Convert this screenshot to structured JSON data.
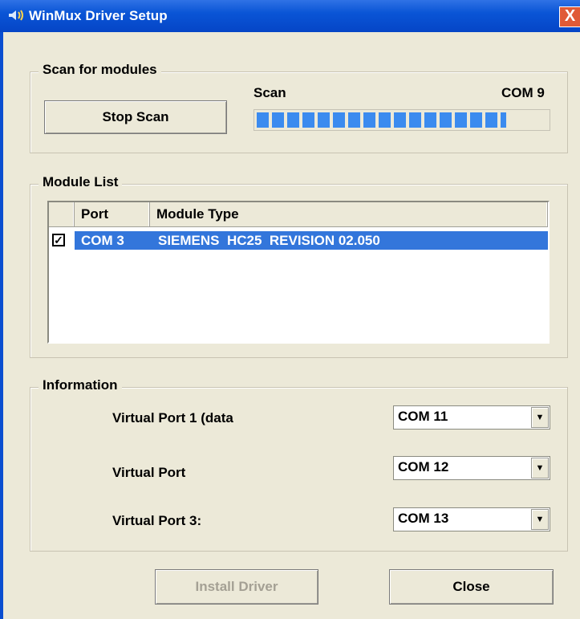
{
  "window": {
    "title": "WinMux Driver Setup",
    "close_glyph": "X"
  },
  "scan": {
    "group_title": "Scan for modules",
    "stop_button": "Stop Scan",
    "status_label": "Scan",
    "current_port": "COM 9",
    "progress_fraction": 0.86
  },
  "modules": {
    "group_title": "Module List",
    "columns": [
      "Port",
      "Module Type"
    ],
    "rows": [
      {
        "checked": true,
        "port": "COM 3",
        "type": "SIEMENS  HC25  REVISION 02.050"
      }
    ]
  },
  "info": {
    "group_title": "Information",
    "ports": [
      {
        "label": "Virtual Port 1 (data",
        "value": "COM 11"
      },
      {
        "label": "Virtual Port",
        "value": "COM 12"
      },
      {
        "label": "Virtual Port 3:",
        "value": "COM 13"
      }
    ]
  },
  "footer": {
    "install_label": "Install Driver",
    "close_label": "Close"
  },
  "colors": {
    "titlebar": "#0a55d6",
    "selection": "#3376db",
    "progress": "#3b8bef",
    "close_button": "#e05a37"
  },
  "icons": {
    "app": "speaker-icon",
    "dropdown": "chevron-down-icon",
    "check": "check-icon"
  }
}
